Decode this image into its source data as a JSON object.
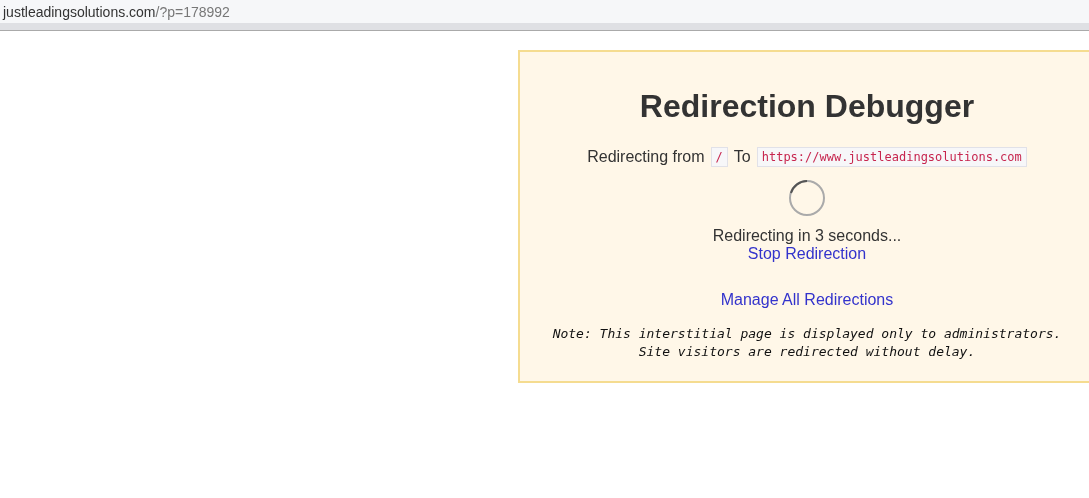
{
  "address_bar": {
    "host": "justleadingsolutions.com",
    "path": "/?p=178992"
  },
  "panel": {
    "title": "Redirection Debugger",
    "from_label": "Redirecting from",
    "from_value": "/",
    "to_label": "To",
    "to_value": "https://www.justleadingsolutions.com",
    "countdown": "Redirecting in 3 seconds...",
    "stop_link": "Stop Redirection",
    "manage_link": "Manage All Redirections",
    "note_lines": [
      "Note: This interstitial page is displayed only to administrators.",
      "Site visitors are redirected without delay."
    ]
  }
}
